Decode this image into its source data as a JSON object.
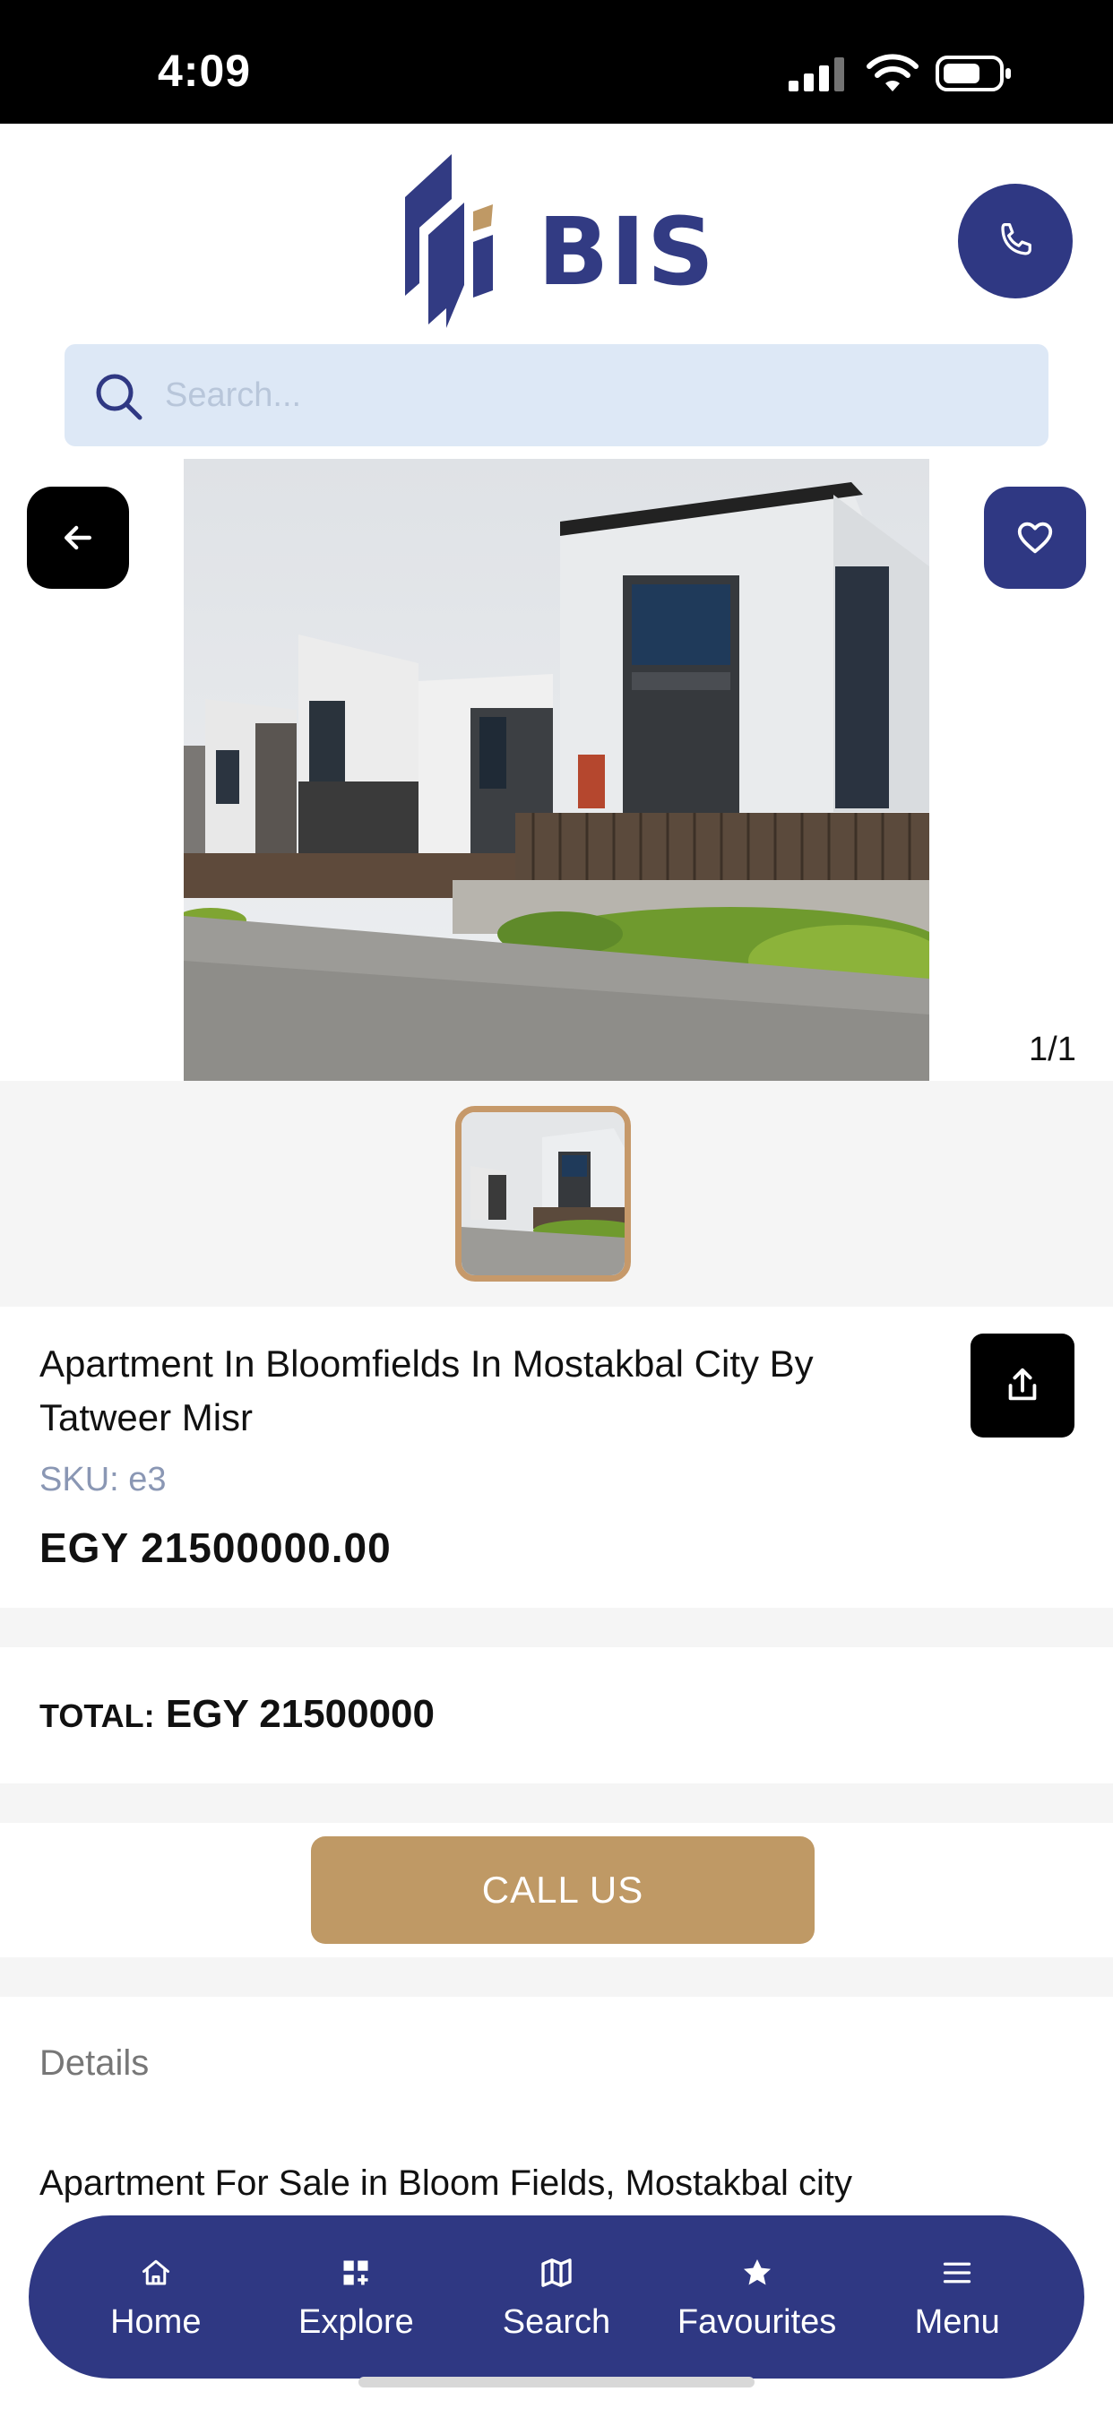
{
  "status_bar": {
    "time": "4:09"
  },
  "header": {
    "logo_text": "BIS"
  },
  "search": {
    "placeholder": "Search..."
  },
  "gallery": {
    "counter": "1/1"
  },
  "product": {
    "title": "Apartment In Bloomfields In Mostakbal City By Tatweer Misr",
    "sku": "SKU: e3",
    "price": "EGY 21500000.00"
  },
  "total": {
    "label": "TOTAL:",
    "value": "EGY 21500000"
  },
  "cta": {
    "call_label": "CALL US"
  },
  "details": {
    "heading": "Details",
    "text": "Apartment For Sale in Bloom Fields, Mostakbal city"
  },
  "bottom_nav": {
    "items": [
      {
        "label": "Home",
        "icon": "home-icon"
      },
      {
        "label": "Explore",
        "icon": "explore-icon"
      },
      {
        "label": "Search",
        "icon": "map-icon"
      },
      {
        "label": "Favourites",
        "icon": "star-icon"
      },
      {
        "label": "Menu",
        "icon": "menu-icon"
      }
    ]
  },
  "colors": {
    "brand_navy": "#2f3883",
    "brand_gold": "#bf9965",
    "search_bg": "#dde8f6"
  }
}
